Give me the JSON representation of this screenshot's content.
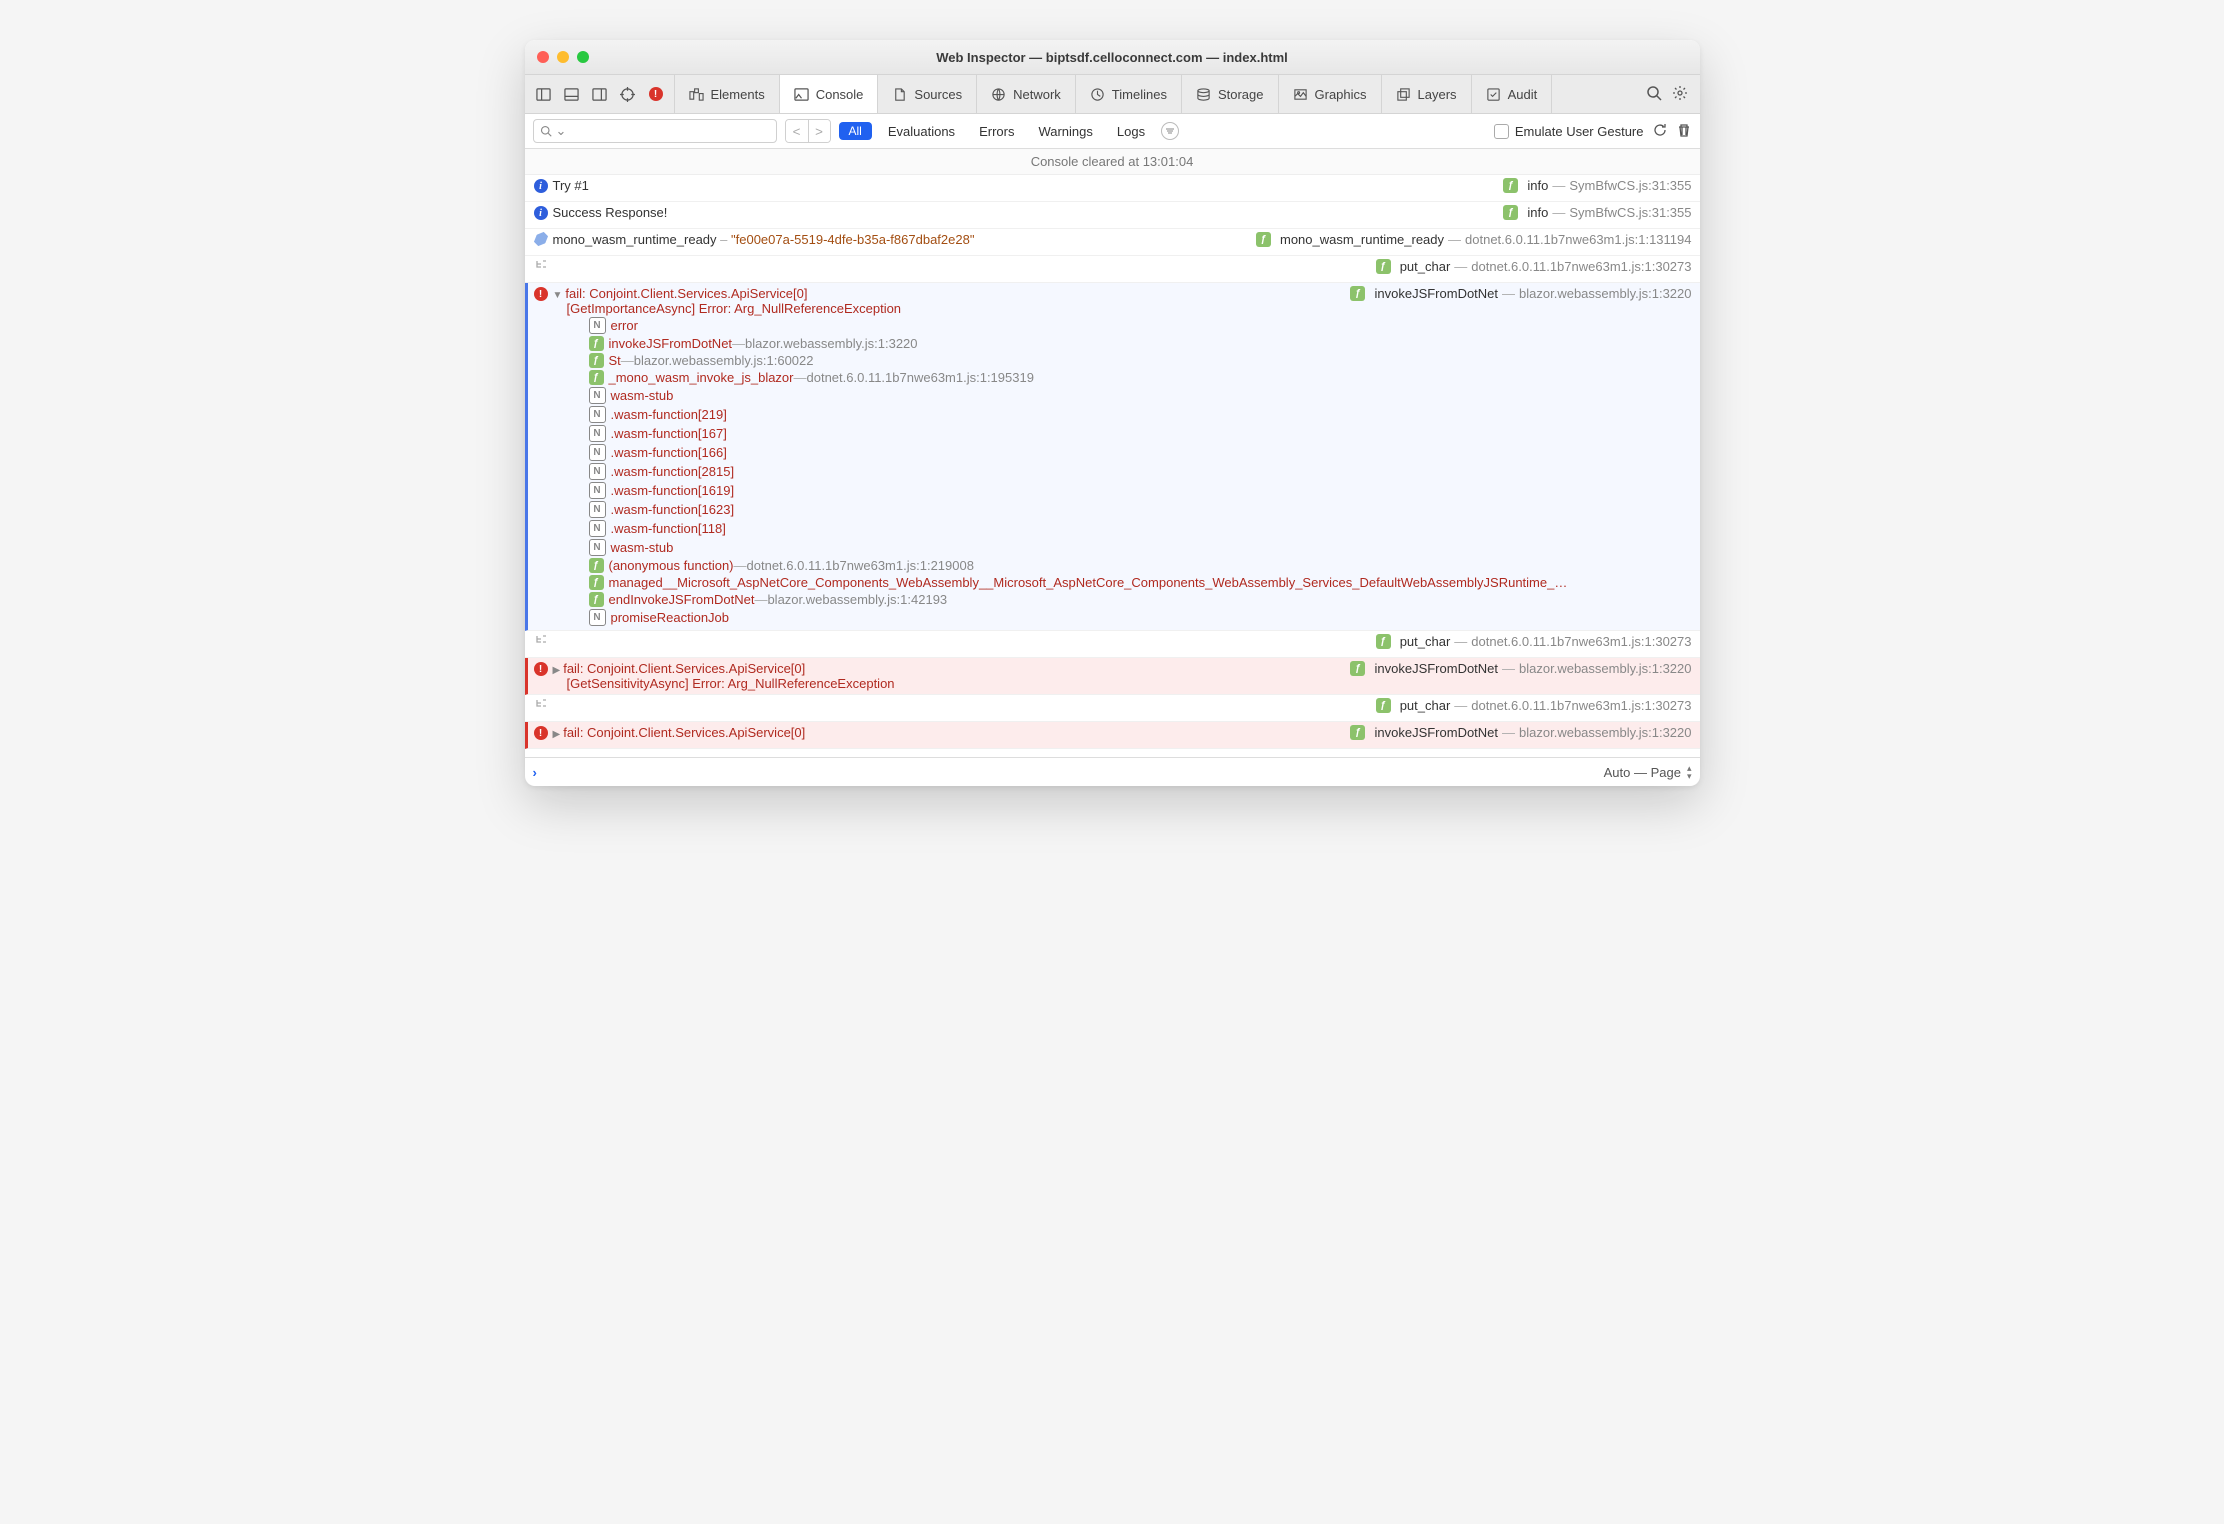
{
  "window_title": "Web Inspector — biptsdf.celloconnect.com — index.html",
  "tabs": [
    "Elements",
    "Console",
    "Sources",
    "Network",
    "Timelines",
    "Storage",
    "Graphics",
    "Layers",
    "Audit"
  ],
  "active_tab_index": 1,
  "filters": {
    "all": "All",
    "evaluations": "Evaluations",
    "errors": "Errors",
    "warnings": "Warnings",
    "logs": "Logs"
  },
  "emulate": "Emulate User Gesture",
  "banner": "Console cleared at 13:01:04",
  "search_symbol": "⌄",
  "rows": [
    {
      "type": "info",
      "msg": "Try #1",
      "srcBadge": "f",
      "srcFn": "info",
      "srcLoc": "SymBfwCS.js:31:355"
    },
    {
      "type": "info",
      "msg": "Success Response!",
      "srcBadge": "f",
      "srcFn": "info",
      "srcLoc": "SymBfwCS.js:31:355"
    },
    {
      "type": "tag",
      "msg_a": "mono_wasm_runtime_ready",
      "msg_b": "\"fe00e07a-5519-4dfe-b35a-f867dbaf2e28\"",
      "srcBadge": "f",
      "srcFn": "mono_wasm_runtime_ready",
      "srcLoc": "dotnet.6.0.11.1b7nwe63m1.js:1:131194"
    },
    {
      "type": "tree",
      "srcBadge": "f",
      "srcFn": "put_char",
      "srcLoc": "dotnet.6.0.11.1b7nwe63m1.js:1:30273"
    }
  ],
  "error1": {
    "head": "fail: Conjoint.Client.Services.ApiService[0]",
    "sub": "[GetImportanceAsync] Error: Arg_NullReferenceException",
    "srcBadge": "f",
    "srcFn": "invokeJSFromDotNet",
    "srcLoc": "blazor.webassembly.js:1:3220",
    "stack": [
      {
        "b": "n",
        "t": "error"
      },
      {
        "b": "f",
        "t": "invokeJSFromDotNet",
        "loc": "blazor.webassembly.js:1:3220"
      },
      {
        "b": "f",
        "t": "St",
        "loc": "blazor.webassembly.js:1:60022"
      },
      {
        "b": "f",
        "t": "_mono_wasm_invoke_js_blazor",
        "loc": "dotnet.6.0.11.1b7nwe63m1.js:1:195319"
      },
      {
        "b": "n",
        "t": "wasm-stub"
      },
      {
        "b": "n",
        "t": "<?>.wasm-function[219]"
      },
      {
        "b": "n",
        "t": "<?>.wasm-function[167]"
      },
      {
        "b": "n",
        "t": "<?>.wasm-function[166]"
      },
      {
        "b": "n",
        "t": "<?>.wasm-function[2815]"
      },
      {
        "b": "n",
        "t": "<?>.wasm-function[1619]"
      },
      {
        "b": "n",
        "t": "<?>.wasm-function[1623]"
      },
      {
        "b": "n",
        "t": "<?>.wasm-function[118]"
      },
      {
        "b": "n",
        "t": "wasm-stub"
      },
      {
        "b": "f",
        "t": "(anonymous function)",
        "loc": "dotnet.6.0.11.1b7nwe63m1.js:1:219008"
      },
      {
        "b": "f",
        "t": "managed__Microsoft_AspNetCore_Components_WebAssembly__Microsoft_AspNetCore_Components_WebAssembly_Services_DefaultWebAssemblyJSRuntime_…"
      },
      {
        "b": "f",
        "t": "endInvokeJSFromDotNet",
        "loc": "blazor.webassembly.js:1:42193"
      },
      {
        "b": "n",
        "t": "promiseReactionJob"
      }
    ]
  },
  "putchar2": {
    "srcBadge": "f",
    "srcFn": "put_char",
    "srcLoc": "dotnet.6.0.11.1b7nwe63m1.js:1:30273"
  },
  "error2": {
    "head": "fail: Conjoint.Client.Services.ApiService[0]",
    "sub": "[GetSensitivityAsync] Error: Arg_NullReferenceException",
    "srcBadge": "f",
    "srcFn": "invokeJSFromDotNet",
    "srcLoc": "blazor.webassembly.js:1:3220"
  },
  "putchar3": {
    "srcBadge": "f",
    "srcFn": "put_char",
    "srcLoc": "dotnet.6.0.11.1b7nwe63m1.js:1:30273"
  },
  "error3": {
    "head": "fail: Conjoint.Client.Services.ApiService[0]",
    "srcBadge": "f",
    "srcFn": "invokeJSFromDotNet",
    "srcLoc": "blazor.webassembly.js:1:3220"
  },
  "context_label": "Auto — Page"
}
